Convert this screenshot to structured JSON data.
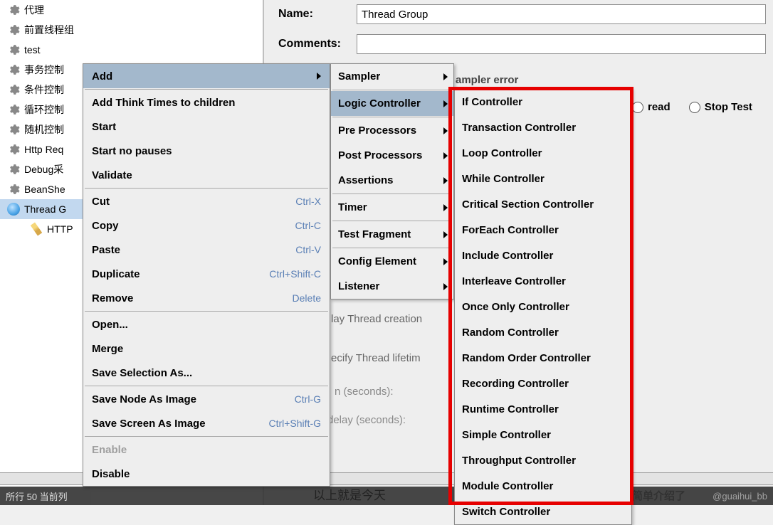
{
  "tree": {
    "items": [
      {
        "label": "代理"
      },
      {
        "label": "前置线程组"
      },
      {
        "label": "test"
      },
      {
        "label": "事务控制"
      },
      {
        "label": "条件控制"
      },
      {
        "label": "循环控制"
      },
      {
        "label": "随机控制"
      },
      {
        "label": "Http Req"
      },
      {
        "label": "Debug采"
      },
      {
        "label": "BeanShe"
      },
      {
        "label": "Thread G"
      },
      {
        "label": "HTTP"
      }
    ]
  },
  "props": {
    "name_label": "Name:",
    "name_value": "Thread Group",
    "comments_label": "Comments:",
    "sampler_error_text": "ampler error",
    "radio_thread": "read",
    "radio_stoptest": "Stop Test",
    "delay_thread": "lay Thread creation",
    "specify_lifetime": "ecify Thread lifetim",
    "n_seconds": "n (seconds):",
    "delay_seconds": "   delay (seconds):"
  },
  "context_menu": {
    "items": [
      {
        "label": "Add",
        "arrow": true,
        "highlight": true
      },
      {
        "label": "Add Think Times to children"
      },
      {
        "label": "Start"
      },
      {
        "label": "Start no pauses"
      },
      {
        "label": "Validate"
      }
    ],
    "edit": [
      {
        "label": "Cut",
        "shortcut": "Ctrl-X"
      },
      {
        "label": "Copy",
        "shortcut": "Ctrl-C"
      },
      {
        "label": "Paste",
        "shortcut": "Ctrl-V"
      },
      {
        "label": "Duplicate",
        "shortcut": "Ctrl+Shift-C"
      },
      {
        "label": "Remove",
        "shortcut": "Delete"
      }
    ],
    "file": [
      {
        "label": "Open..."
      },
      {
        "label": "Merge"
      },
      {
        "label": "Save Selection As..."
      }
    ],
    "image": [
      {
        "label": "Save Node As Image",
        "shortcut": "Ctrl-G"
      },
      {
        "label": "Save Screen As Image",
        "shortcut": "Ctrl+Shift-G"
      }
    ],
    "toggle": [
      {
        "label": "Enable",
        "disabled": true
      },
      {
        "label": "Disable"
      }
    ]
  },
  "add_submenu": [
    {
      "label": "Sampler",
      "arrow": true
    },
    {
      "label": "Logic Controller",
      "arrow": true,
      "highlight": true
    },
    {
      "label": "Pre Processors",
      "arrow": true
    },
    {
      "label": "Post Processors",
      "arrow": true
    },
    {
      "label": "Assertions",
      "arrow": true
    },
    {
      "label": "Timer",
      "arrow": true
    },
    {
      "label": "Test Fragment",
      "arrow": true
    },
    {
      "label": "Config Element",
      "arrow": true
    },
    {
      "label": "Listener",
      "arrow": true
    }
  ],
  "logic_submenu": [
    "If Controller",
    "Transaction Controller",
    "Loop Controller",
    "While Controller",
    "Critical Section Controller",
    "ForEach Controller",
    "Include Controller",
    "Interleave Controller",
    "Once Only Controller",
    "Random Controller",
    "Random Order Controller",
    "Recording Controller",
    "Runtime Controller",
    "Simple Controller",
    "Throughput Controller",
    "Module Controller",
    "Switch Controller"
  ],
  "footer": {
    "left": "所行 50  当前列",
    "cn": "以上就是今天",
    "cn2": "简单介绍了",
    "watermark": "@guaihui_bb"
  }
}
